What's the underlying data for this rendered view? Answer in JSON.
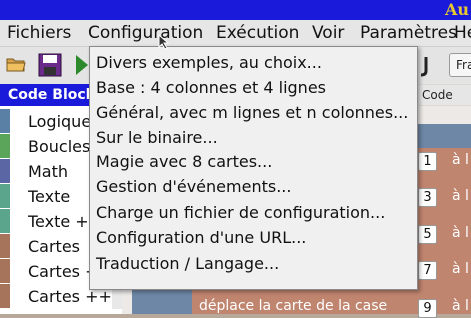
{
  "window": {
    "title_fragment": "Au"
  },
  "menubar": {
    "items": [
      "Fichiers",
      "Configuration",
      "Exécution",
      "Voir",
      "Paramètres",
      "He"
    ]
  },
  "toolbar": {
    "icons": [
      "folder-open-icon",
      "save-icon",
      "run-icon"
    ],
    "language_button": "Fra"
  },
  "config_menu": {
    "items": [
      "Divers exemples, au choix...",
      "Base : 4 colonnes et 4 lignes",
      "Général, avec m lignes et n colonnes...",
      "Sur le binaire...",
      "Magie avec 8 cartes...",
      "Gestion d'événements...",
      "Charge un fichier de configuration...",
      "Configuration d'une URL...",
      "Traduction / Langage..."
    ]
  },
  "code_blocks": {
    "header": "Code Blocks",
    "categories": [
      {
        "label": "Logique",
        "color": "#5b80a5"
      },
      {
        "label": "Boucles",
        "color": "#5ba55b"
      },
      {
        "label": "Math",
        "color": "#5b67a5"
      },
      {
        "label": "Texte",
        "color": "#5ba58c"
      },
      {
        "label": "Texte +",
        "color": "#5ba58c"
      },
      {
        "label": "Cartes",
        "color": "#a5745b"
      },
      {
        "label": "Cartes +",
        "color": "#a5745b"
      },
      {
        "label": "Cartes ++",
        "color": "#a5745b"
      }
    ]
  },
  "workspace": {
    "code_tab": "Code",
    "blocks": [
      {
        "number": "1",
        "text": "à l"
      },
      {
        "number": "3",
        "text": "à l"
      },
      {
        "number": "5",
        "text": "à l"
      },
      {
        "number": "7",
        "text": "à l"
      },
      {
        "number": "9",
        "text": "à l"
      }
    ],
    "bottom_block_text": "déplace la carte de la case"
  }
}
